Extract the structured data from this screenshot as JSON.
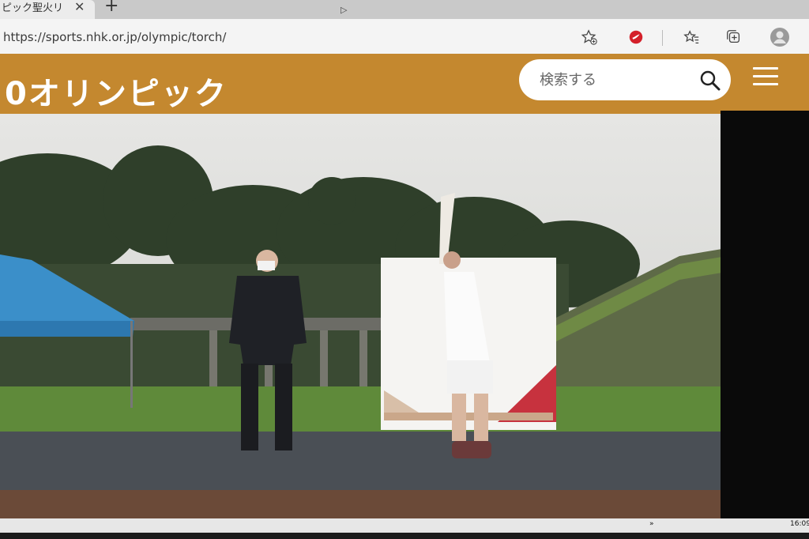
{
  "browser": {
    "tab_title": "ピック聖火リレ",
    "tab_close": "✕",
    "new_tab": "+",
    "url": "https://sports.nhk.or.jp/olympic/torch/"
  },
  "site": {
    "logo": "0オリンピック",
    "search_placeholder": "検索する"
  },
  "taskbar": {
    "tray_chevron": "»",
    "clock": "16:09"
  },
  "colors": {
    "header": "#c4882f",
    "tent": "#3b8fc9",
    "ground": "#5f8a3a"
  }
}
